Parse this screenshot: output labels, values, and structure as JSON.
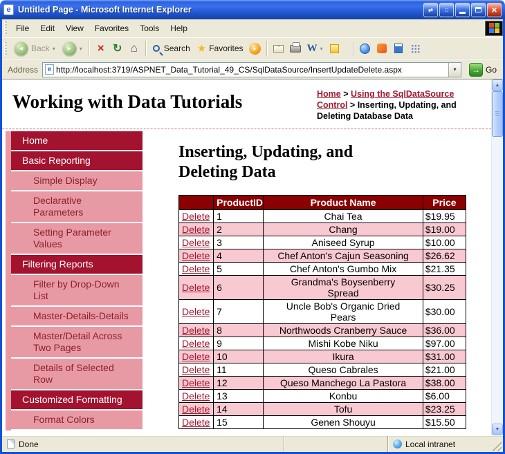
{
  "colors": {
    "titlebar_blue": "#1C50C8",
    "window_border": "#1252D8",
    "chrome_beige": "#ECE9D8",
    "maroon_dark": "#8B0000",
    "maroon": "#A3132F",
    "pink": "#E89AA4",
    "pink_row": "#F9C9D1",
    "link_maroon": "#9E1B32",
    "go_green": "#47A838"
  },
  "titlebar": {
    "title": "Untitled Page - Microsoft Internet Explorer"
  },
  "menubar": {
    "items": [
      "File",
      "Edit",
      "View",
      "Favorites",
      "Tools",
      "Help"
    ]
  },
  "toolbar": {
    "back_label": "Back",
    "search_label": "Search",
    "favorites_label": "Favorites"
  },
  "addressbar": {
    "label": "Address",
    "url": "http://localhost:3719/ASPNET_Data_Tutorial_49_CS/SqlDataSource/InsertUpdateDelete.aspx",
    "go_label": "Go"
  },
  "statusbar": {
    "status": "Done",
    "zone": "Local intranet"
  },
  "icons": {
    "ie_e": "e",
    "swap": "⇄",
    "window": "□",
    "close": "×",
    "back": "◄",
    "forward": "►",
    "dropdown": "▾",
    "stop": "×",
    "refresh": "↻",
    "home": "⌂",
    "favorites_star": "★",
    "media_play": "▸",
    "word": "W",
    "go_arrow": "→",
    "scroll_up": "▲",
    "scroll_down": "▼"
  },
  "page": {
    "site_title": "Working with Data Tutorials",
    "breadcrumb": {
      "separator": ">",
      "items": [
        {
          "label": "Home",
          "link": true
        },
        {
          "label": "Using the SqlDataSource Control",
          "link": true
        },
        {
          "label": "Inserting, Updating, and Deleting Database Data",
          "link": false
        }
      ]
    },
    "heading": "Inserting, Updating, and Deleting Data",
    "sidebar_items": [
      {
        "label": "Home",
        "level": "main"
      },
      {
        "label": "Basic Reporting",
        "level": "main"
      },
      {
        "label": "Simple Display",
        "level": "sub"
      },
      {
        "label": "Declarative Parameters",
        "level": "sub"
      },
      {
        "label": "Setting Parameter Values",
        "level": "sub"
      },
      {
        "label": "Filtering Reports",
        "level": "main"
      },
      {
        "label": "Filter by Drop-Down List",
        "level": "sub"
      },
      {
        "label": "Master-Details-Details",
        "level": "sub"
      },
      {
        "label": "Master/Detail Across Two Pages",
        "level": "sub"
      },
      {
        "label": "Details of Selected Row",
        "level": "sub"
      },
      {
        "label": "Customized Formatting",
        "level": "main"
      },
      {
        "label": "Format Colors",
        "level": "sub"
      }
    ],
    "table": {
      "delete_label": "Delete",
      "headers": [
        "",
        "ProductID",
        "Product Name",
        "Price"
      ],
      "rows": [
        {
          "id": 1,
          "name": "Chai Tea",
          "price": "$19.95"
        },
        {
          "id": 2,
          "name": "Chang",
          "price": "$19.00"
        },
        {
          "id": 3,
          "name": "Aniseed Syrup",
          "price": "$10.00"
        },
        {
          "id": 4,
          "name": "Chef Anton's Cajun Seasoning",
          "price": "$26.62"
        },
        {
          "id": 5,
          "name": "Chef Anton's Gumbo Mix",
          "price": "$21.35"
        },
        {
          "id": 6,
          "name": "Grandma's Boysenberry Spread",
          "price": "$30.25"
        },
        {
          "id": 7,
          "name": "Uncle Bob's Organic Dried Pears",
          "price": "$30.00"
        },
        {
          "id": 8,
          "name": "Northwoods Cranberry Sauce",
          "price": "$36.00"
        },
        {
          "id": 9,
          "name": "Mishi Kobe Niku",
          "price": "$97.00"
        },
        {
          "id": 10,
          "name": "Ikura",
          "price": "$31.00"
        },
        {
          "id": 11,
          "name": "Queso Cabrales",
          "price": "$21.00"
        },
        {
          "id": 12,
          "name": "Queso Manchego La Pastora",
          "price": "$38.00"
        },
        {
          "id": 13,
          "name": "Konbu",
          "price": "$6.00"
        },
        {
          "id": 14,
          "name": "Tofu",
          "price": "$23.25"
        },
        {
          "id": 15,
          "name": "Genen Shouyu",
          "price": "$15.50"
        }
      ]
    }
  }
}
